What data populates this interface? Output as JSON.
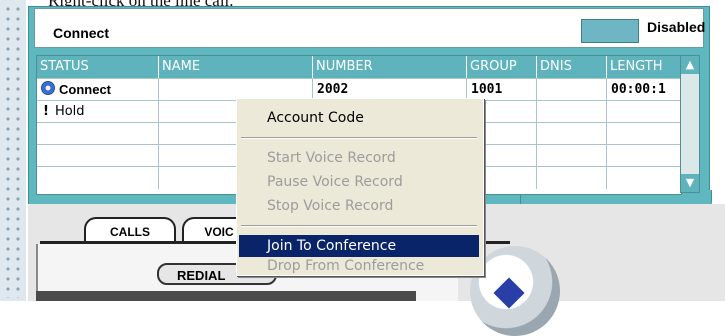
{
  "caption": "Right-click on the line call.",
  "status": {
    "label": "Connect",
    "indicator_label": "Disabled",
    "indicator_color": "#6fb6c5"
  },
  "table": {
    "columns": [
      "STATUS",
      "NAME",
      "NUMBER",
      "GROUP",
      "DNIS",
      "LENGTH"
    ],
    "rows": [
      {
        "status": "Connect",
        "name": "",
        "number": "2002",
        "group": "1001",
        "dnis": "",
        "length": "00:00:1"
      },
      {
        "status": "Hold",
        "name": "",
        "number": "",
        "group": "",
        "dnis": "",
        "length": ""
      },
      {
        "status": "",
        "name": "",
        "number": "",
        "group": "",
        "dnis": "",
        "length": ""
      },
      {
        "status": "",
        "name": "",
        "number": "",
        "group": "",
        "dnis": "",
        "length": ""
      },
      {
        "status": "",
        "name": "",
        "number": "",
        "group": "",
        "dnis": "",
        "length": ""
      }
    ]
  },
  "tabs": [
    "CALLS",
    "VOIC"
  ],
  "redial_label": "REDIAL",
  "context_menu": {
    "items": [
      {
        "label": "Account Code",
        "state": "enabled"
      },
      {
        "label": "Start Voice Record",
        "state": "disabled"
      },
      {
        "label": "Pause Voice Record",
        "state": "disabled"
      },
      {
        "label": "Stop Voice Record",
        "state": "disabled"
      },
      {
        "label": "Join To Conference",
        "state": "selected"
      },
      {
        "label": "Drop From Conference",
        "state": "disabled"
      }
    ]
  },
  "colors": {
    "frame": "#5fb8c0",
    "menu_highlight": "#0a246a",
    "knob_accent": "#2a3ea8"
  }
}
